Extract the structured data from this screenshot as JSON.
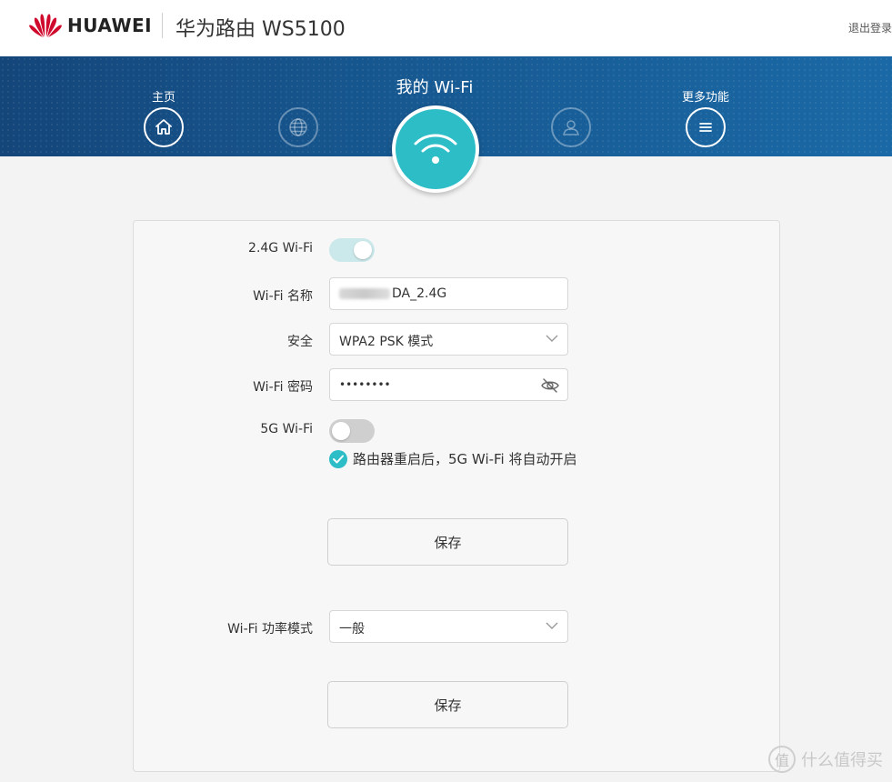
{
  "header": {
    "brand": "HUAWEI",
    "product": "华为路由 WS5100",
    "logout": "退出登录",
    "brand_color": "#cf0a2c"
  },
  "nav": {
    "home_label": "主页",
    "center_title": "我的 Wi-Fi",
    "more_label": "更多功能",
    "items": [
      {
        "icon": "home-icon",
        "active": false
      },
      {
        "icon": "globe-icon",
        "active": false
      },
      {
        "icon": "wifi-icon",
        "active": true
      },
      {
        "icon": "user-icon",
        "active": false
      },
      {
        "icon": "menu-icon",
        "active": false
      }
    ]
  },
  "wifi": {
    "wifi24_label": "2.4G Wi-Fi",
    "wifi24_enabled": true,
    "name_label": "Wi-Fi 名称",
    "name_value": "DA_2.4G",
    "security_label": "安全",
    "security_value": "WPA2 PSK 模式",
    "password_label": "Wi-Fi 密码",
    "password_value": "••••••••",
    "wifi5_label": "5G Wi-Fi",
    "wifi5_enabled": false,
    "hint": "路由器重启后，5G Wi-Fi 将自动开启",
    "save_label": "保存"
  },
  "power": {
    "label": "Wi-Fi 功率模式",
    "value": "一般",
    "save_label": "保存"
  },
  "watermark": {
    "badge": "值",
    "text": "什么值得买"
  },
  "colors": {
    "accent": "#2cbdc7",
    "nav_blue": "#175a93"
  }
}
